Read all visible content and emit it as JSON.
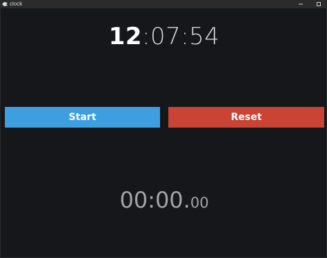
{
  "window": {
    "title": "clock",
    "controls": {
      "minimize_icon": "minimize-icon",
      "maximize_icon": "maximize-icon"
    }
  },
  "clock": {
    "hours": "12",
    "rest": ":07:54"
  },
  "buttons": {
    "start_label": "Start",
    "reset_label": "Reset",
    "start_color": "#3d9fe0",
    "reset_color": "#c94435"
  },
  "stopwatch": {
    "main": "00:00.",
    "centis": "00"
  }
}
